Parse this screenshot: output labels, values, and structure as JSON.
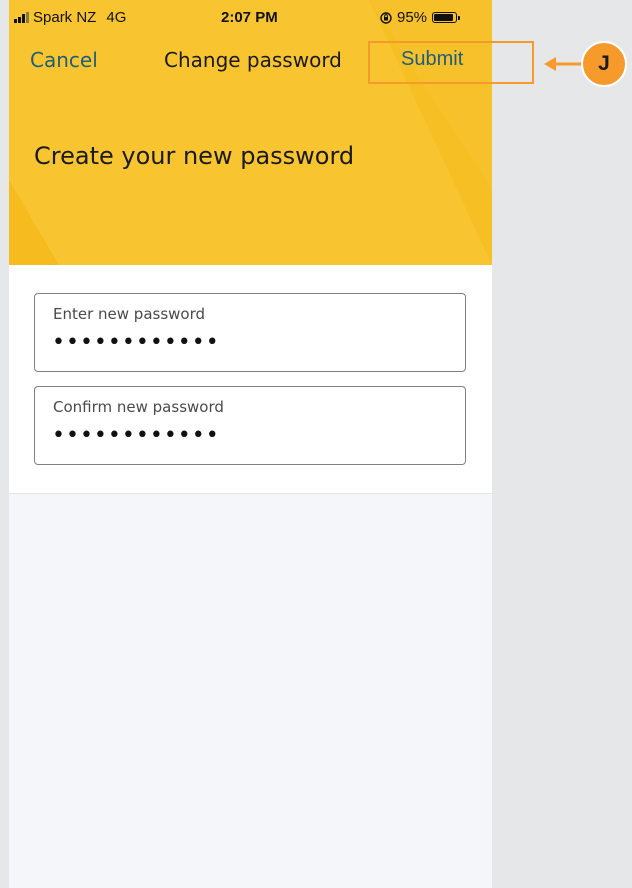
{
  "status_bar": {
    "carrier": "Spark NZ",
    "network": "4G",
    "time": "2:07 PM",
    "battery": "95%",
    "battery_level": 0.95
  },
  "nav": {
    "cancel_label": "Cancel",
    "title": "Change password",
    "submit_label": "Submit"
  },
  "hero": {
    "heading": "Create your new password"
  },
  "form": {
    "new_password": {
      "label": "Enter new password",
      "value": "••••••••••••"
    },
    "confirm_password": {
      "label": "Confirm new password",
      "value": "••••••••••••"
    }
  },
  "annotation": {
    "badge": "J"
  },
  "colors": {
    "hero_yellow": "#f6bf24",
    "link_blue": "#1e5e7a",
    "annotation_orange": "#f59a2b"
  }
}
